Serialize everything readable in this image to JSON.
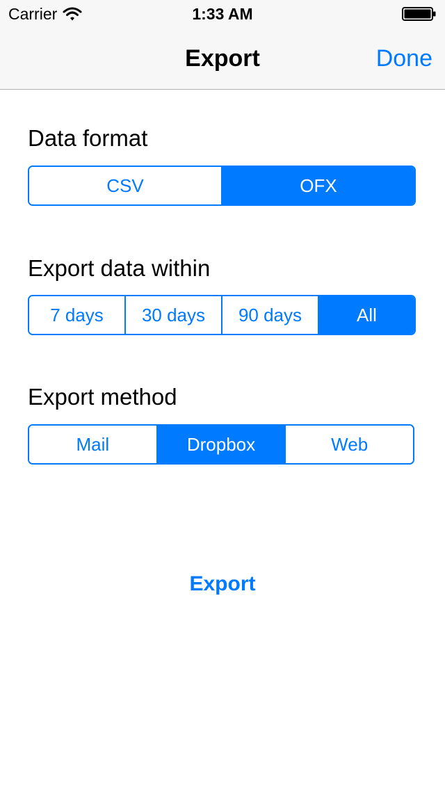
{
  "status_bar": {
    "carrier": "Carrier",
    "time": "1:33 AM",
    "wifi_icon": "wifi-icon",
    "battery_icon": "battery-full-icon"
  },
  "nav": {
    "title": "Export",
    "done_label": "Done"
  },
  "sections": {
    "data_format": {
      "label": "Data format",
      "options": [
        "CSV",
        "OFX"
      ],
      "selected": "OFX"
    },
    "date_range": {
      "label": "Export data within",
      "options": [
        "7 days",
        "30 days",
        "90 days",
        "All"
      ],
      "selected": "All"
    },
    "method": {
      "label": "Export method",
      "options": [
        "Mail",
        "Dropbox",
        "Web"
      ],
      "selected": "Dropbox"
    }
  },
  "export_button": "Export",
  "colors": {
    "accent": "#007aff",
    "bar_background": "#f7f7f7",
    "separator": "#b2b2b2"
  }
}
